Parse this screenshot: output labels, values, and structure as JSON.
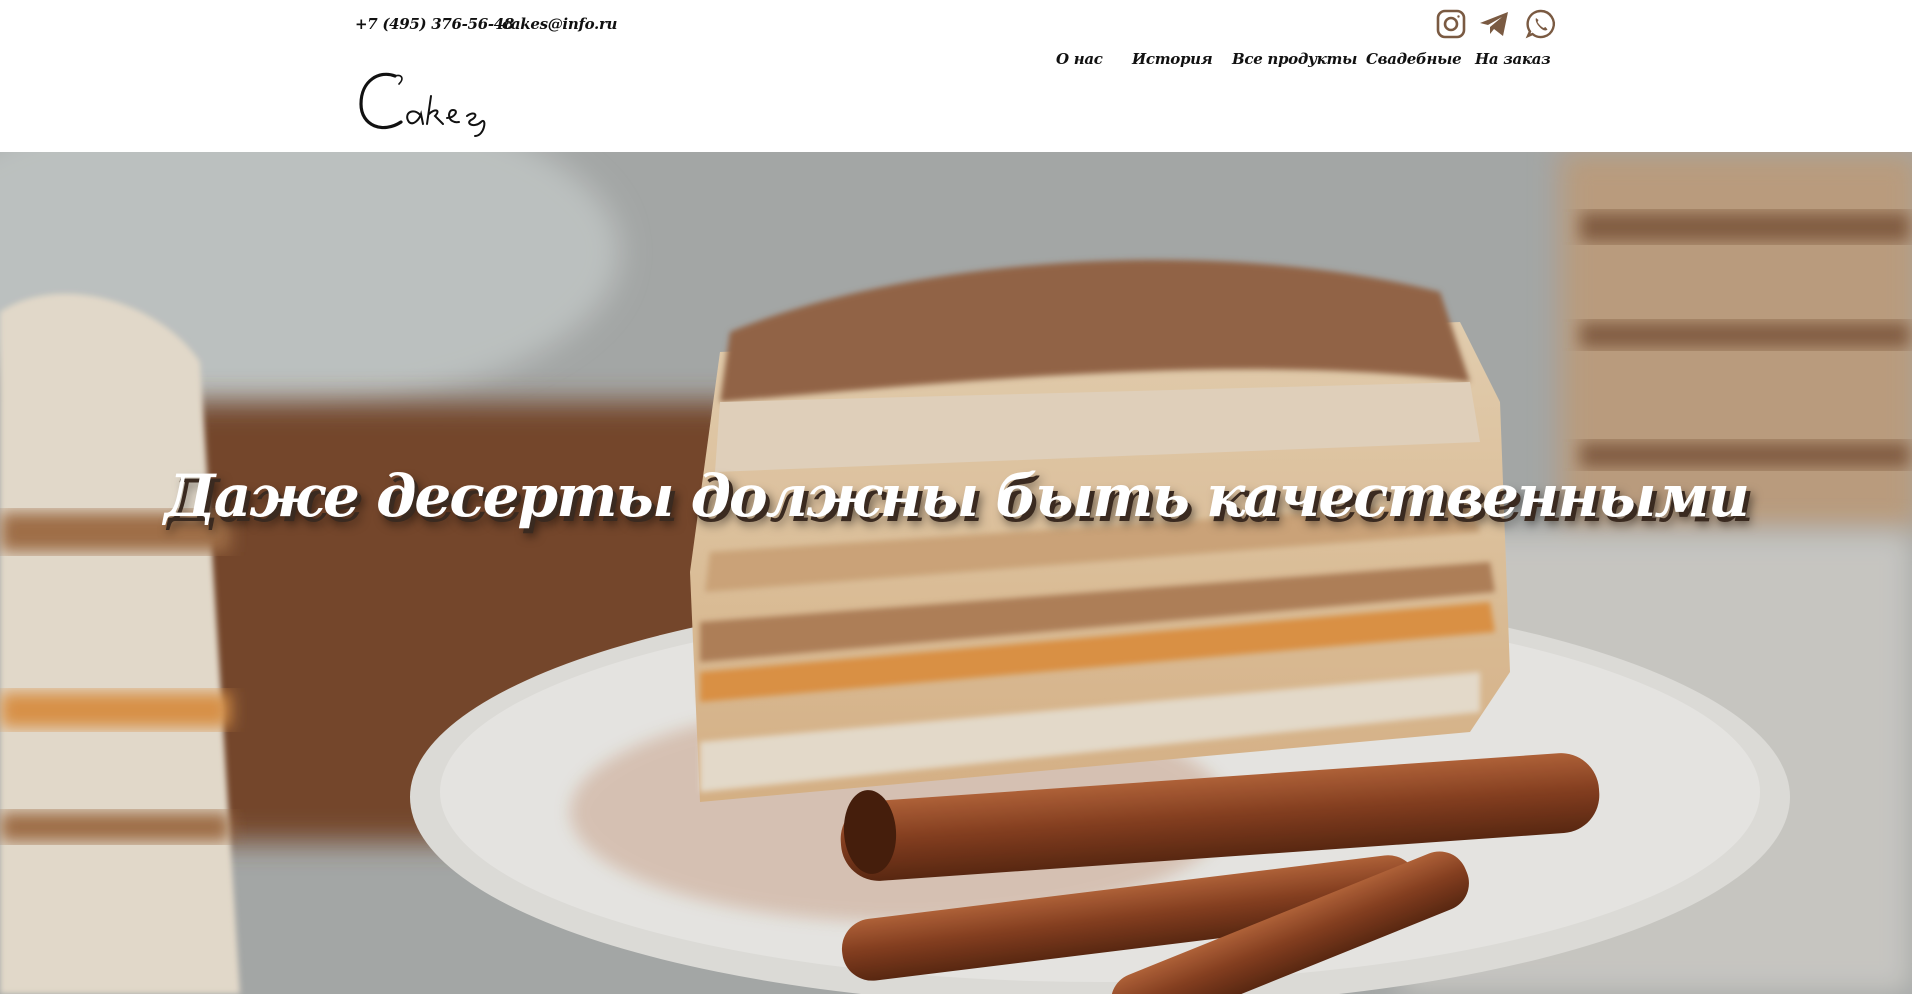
{
  "contacts": {
    "phone": "+7 (495) 376-56-48",
    "email": "cakes@info.ru"
  },
  "social": {
    "icons": [
      "instagram-icon",
      "telegram-icon",
      "whatsapp-icon"
    ],
    "color": "#7a5a42"
  },
  "logo": {
    "text": "Cakes"
  },
  "nav": {
    "items": [
      {
        "label": "О нас"
      },
      {
        "label": "История"
      },
      {
        "label": "Все продукты"
      },
      {
        "label": "Свадебные"
      },
      {
        "label": "На заказ"
      }
    ]
  },
  "hero": {
    "title": "Даже десерты должны быть качественными"
  }
}
